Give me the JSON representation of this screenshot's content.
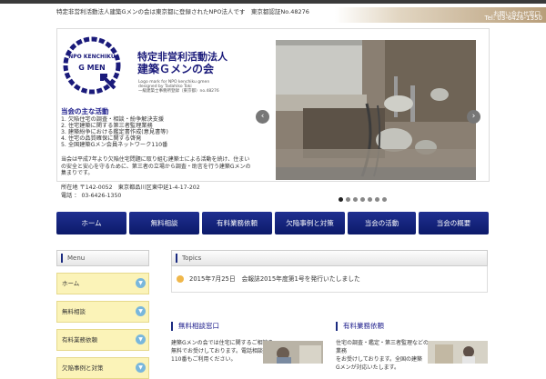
{
  "header": {
    "tagline": "特定非営利活動法人建築Gメンの会は東京都に登録されたNPO法人です　東京都認証No.48276",
    "contact_top": "お問い合わせ窓口",
    "contact_tel": "Tel: 03-6426-1350"
  },
  "logo": {
    "ring_top": "NPO KENCHIKU",
    "ring_mid": "G MEN",
    "org_name_1": "特定非営利活動法人",
    "org_name_2": "建築Ｇメンの会",
    "note_1": "Logo mark for NPO kenchiku gmen",
    "note_2": "designed by Tadahiko Toki",
    "note_3": "一級建築士事務所登録（東京都）no.48276"
  },
  "info": {
    "heading": "当会の主な活動",
    "items": [
      "1. 欠陥住宅の調査・相談・紛争解決支援",
      "2. 住宅建築に関する第三者監理業務",
      "3. 建築紛争における鑑定書作成(意見書等)",
      "4. 住宅の品質確保に関する啓発",
      "5. 全国建築Gメン会員ネットワーク110番"
    ],
    "paragraph": "当会は平成7年より欠陥住宅問題に取り組む建築士による活動を続け、住まいの安全と安心を守るために、第三者の立場から調査・助言を行う建築Gメンの集まりです。",
    "address_line": "所在地 〒142-0052　東京都品川区東中延1-4-17-202",
    "tel_line": "電話 ： 03-6426-1350"
  },
  "slider": {
    "prev": "‹",
    "next": "›",
    "dot_count": 7,
    "active_index": 0
  },
  "nav": [
    "ホーム",
    "無料相談",
    "有料業務依頼",
    "欠陥事例と対策",
    "当会の活動",
    "当会の概要"
  ],
  "menu": {
    "title": "Menu",
    "items": [
      "ホーム",
      "無料相談",
      "有料業務依頼",
      "欠陥事例と対策"
    ]
  },
  "topics": {
    "title": "Topics",
    "item": "2015年7月25日　会報誌2015年度第1号を発行いたしました"
  },
  "columns": [
    {
      "heading": "無料相談窓口",
      "text_1": "建築Gメンの会では住宅に関するご相談を",
      "text_2": "無料でお受けしております。電話相談",
      "text_3": "110番もご利用ください。"
    },
    {
      "heading": "有料業務依頼",
      "text_1": "住宅の調査・鑑定・第三者監理などの業務",
      "text_2": "をお受けしております。全国の建築",
      "text_3": "Gメンが対応いたします。"
    }
  ]
}
